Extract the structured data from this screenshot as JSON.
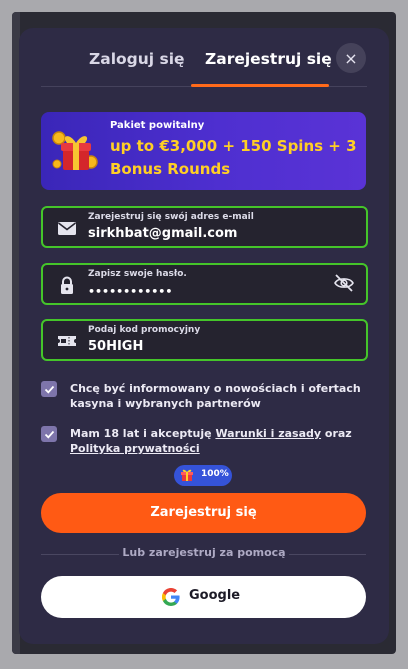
{
  "tabs": {
    "login": "Zaloguj się",
    "register": "Zarejestruj się",
    "active": "register"
  },
  "close_label": "×",
  "promo": {
    "subtitle": "Pakiet powitalny",
    "title": "up to €3,000 + 150 Spins + 3 Bonus Rounds",
    "title_color": "#ffcf25"
  },
  "email_field": {
    "label": "Zarejestruj się swój adres e-mail",
    "value": "sirkhbat@gmail.com",
    "icon": "envelope-icon"
  },
  "password_field": {
    "label": "Zapisz swoje hasło.",
    "value": "••••••••••••",
    "icon": "lock-icon",
    "toggle_icon": "eye-off-icon"
  },
  "promo_code_field": {
    "label": "Podaj kod promocyjny",
    "value": "50HIGH",
    "icon": "ticket-icon"
  },
  "consents": {
    "marketing": {
      "text": "Chcę być informowany o nowościach i ofertach kasyna i wybranych partnerów",
      "checked": true
    },
    "terms": {
      "prefix": "Mam 18 lat i akceptuję",
      "terms_link": "Warunki i zasady",
      "middle": "oraz",
      "privacy_link": "Polityka prywatności",
      "checked": true
    }
  },
  "bonus_badge": {
    "percent": "100%",
    "icon": "gift-icon"
  },
  "submit_label": "Zarejestruj się",
  "alt_signup_label": "Lub zarejestruj za pomocą",
  "google_label": "Google",
  "colors": {
    "accent": "#ff5a14",
    "field_border": "#45c52a",
    "modal_bg": "#2e2b45",
    "badge": "#3553d9"
  }
}
